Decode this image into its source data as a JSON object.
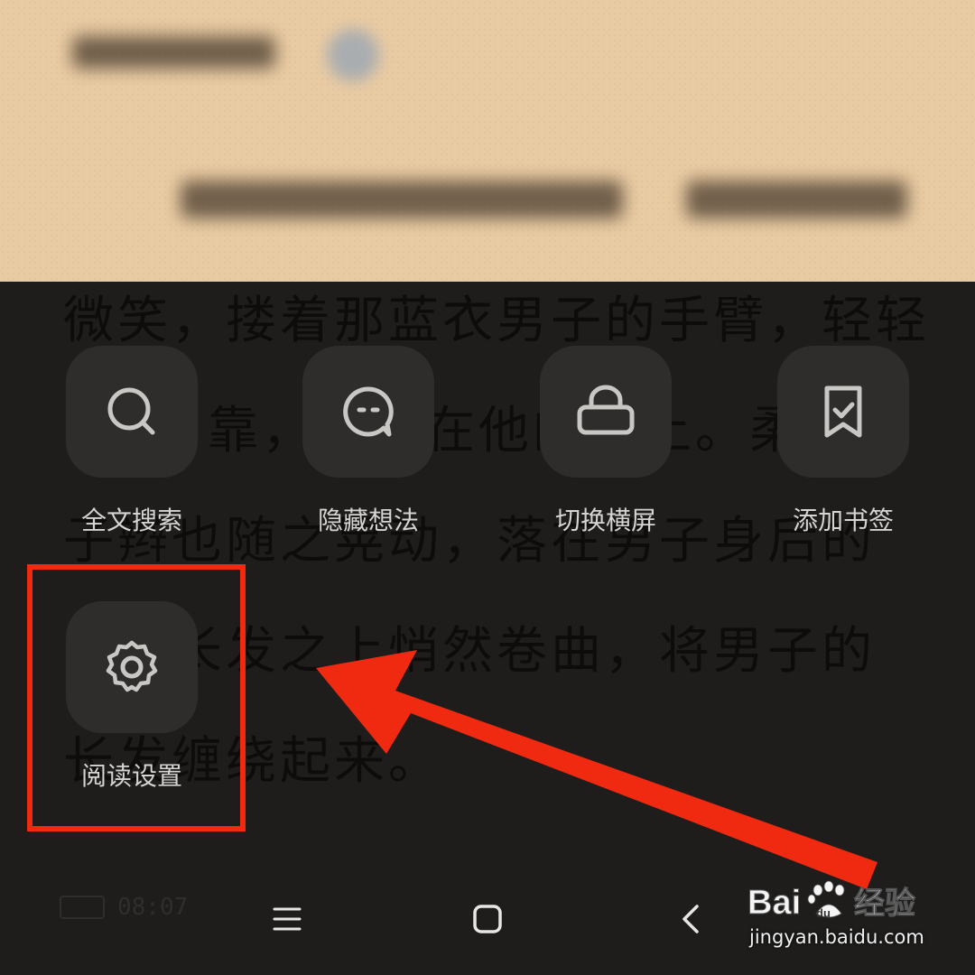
{
  "background_text": {
    "lines": [
      "微笑，搂着那蓝衣男子的手臂，轻轻",
      "靠，头贴在他的肩上。柔顺",
      "子辫也随之晃动，落在男子身后的",
      "苗条长发之上悄然卷曲，将男子的",
      "长发缠绕起来。"
    ]
  },
  "menu": {
    "items": [
      {
        "label": "全文搜索",
        "icon": "search-icon"
      },
      {
        "label": "隐藏想法",
        "icon": "chat-bubble-icon"
      },
      {
        "label": "切换横屏",
        "icon": "rotate-screen-icon"
      },
      {
        "label": "添加书签",
        "icon": "bookmark-check-icon"
      },
      {
        "label": "阅读设置",
        "icon": "gear-icon"
      }
    ]
  },
  "status": {
    "time": "08:07"
  },
  "navigation": {
    "menu_icon": "hamburger-icon",
    "home_icon": "home-square-icon",
    "back_icon": "back-chevron-icon"
  },
  "watermark": {
    "brand": "Bai du 经验",
    "url": "jingyan.baidu.com"
  },
  "colors": {
    "paper": "#e9cba3",
    "overlay": "#1e1d1c",
    "tile": "#2e2d2c",
    "label": "#d6d4d1",
    "annotation": "#ef2a10"
  }
}
